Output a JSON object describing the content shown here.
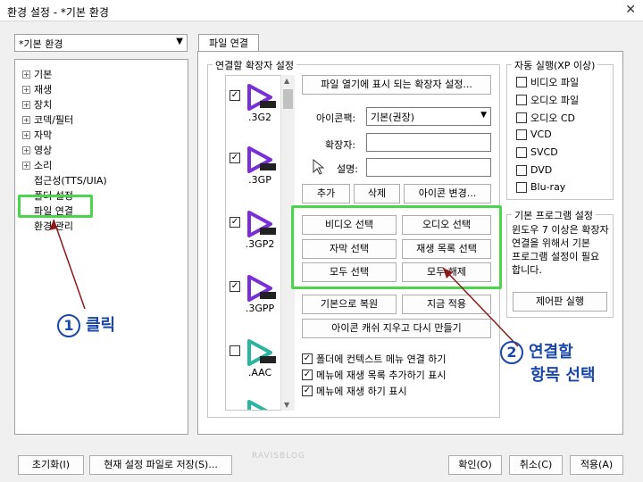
{
  "window": {
    "title": "환경 설정 - *기본 환경",
    "close_glyph": "✕"
  },
  "preset": {
    "value": "*기본 환경"
  },
  "tree": {
    "items": [
      "기본",
      "재생",
      "장치",
      "코덱/필터",
      "자막",
      "영상",
      "소리"
    ],
    "sub_items": [
      "접근성(TTS/UIA)",
      "폴더 설정",
      "파일 연결",
      "환경 관리"
    ],
    "expander": "+"
  },
  "tab": {
    "label": "파일 연결"
  },
  "ext_group": {
    "legend": "연결할 확장자 설정"
  },
  "file_list": [
    {
      "ext": ".3G2",
      "badge": "3G2",
      "checked": true,
      "color": "#7a2fd6"
    },
    {
      "ext": ".3GP",
      "badge": "3GP",
      "checked": true,
      "color": "#7a2fd6"
    },
    {
      "ext": ".3GP2",
      "badge": "3GP2",
      "checked": true,
      "color": "#7a2fd6"
    },
    {
      "ext": ".3GPP",
      "badge": "3GPP",
      "checked": true,
      "color": "#7a2fd6"
    },
    {
      "ext": ".AAC",
      "badge": "AAC",
      "checked": false,
      "color": "#2ab5a0"
    }
  ],
  "buttons": {
    "show_ext": "파일 열기에 표시 되는 확장자 설정...",
    "add": "추가",
    "delete": "삭제",
    "change_icon": "아이콘 변경...",
    "video_select": "비디오 선택",
    "audio_select": "오디오 선택",
    "subtitle_select": "자막 선택",
    "playlist_select": "재생 목록 선택",
    "select_all": "모두 선택",
    "deselect_all": "모두 해제",
    "restore_default": "기본으로 복원",
    "apply_now": "지금 적용",
    "clear_icon_cache": "아이콘 캐쉬 지우고 다시 만들기",
    "control_panel": "제어판 실행"
  },
  "fields": {
    "icon_pack_label": "아이콘팩:",
    "icon_pack_value": "기본(권장)",
    "extension_label": "확장자:",
    "description_label": "설명:"
  },
  "context_options": [
    {
      "label": "폴더에 컨텍스트 메뉴 연결 하기",
      "checked": true
    },
    {
      "label": "메뉴에 재생 목록 추가하기 표시",
      "checked": true
    },
    {
      "label": "메뉴에 재생 하기 표시",
      "checked": true
    }
  ],
  "autorun": {
    "legend": "자동 실행(XP 이상)",
    "items": [
      {
        "label": "비디오 파일",
        "checked": false
      },
      {
        "label": "오디오 파일",
        "checked": false
      },
      {
        "label": "오디오 CD",
        "checked": false
      },
      {
        "label": "VCD",
        "checked": false
      },
      {
        "label": "SVCD",
        "checked": false
      },
      {
        "label": "DVD",
        "checked": false
      },
      {
        "label": "Blu-ray",
        "checked": false
      }
    ]
  },
  "default_program": {
    "legend": "기본 프로그램 설정",
    "text": "윈도우 7 이상은 확장자 연결을 위해서 기본 프로그램 설정이 필요 합니다."
  },
  "annotations": {
    "step1_num": "1",
    "step1_label": "클릭",
    "step2_num": "2",
    "step2_line1": "연결할",
    "step2_line2": "항목 선택",
    "watermark": "RAVISBLOG"
  },
  "bottom_buttons": {
    "reset": "초기화(I)",
    "save_as": "현재 설정 파일로 저장(S)...",
    "ok": "확인(O)",
    "cancel": "취소(C)",
    "apply": "적용(A)"
  },
  "checkmark": "✓"
}
